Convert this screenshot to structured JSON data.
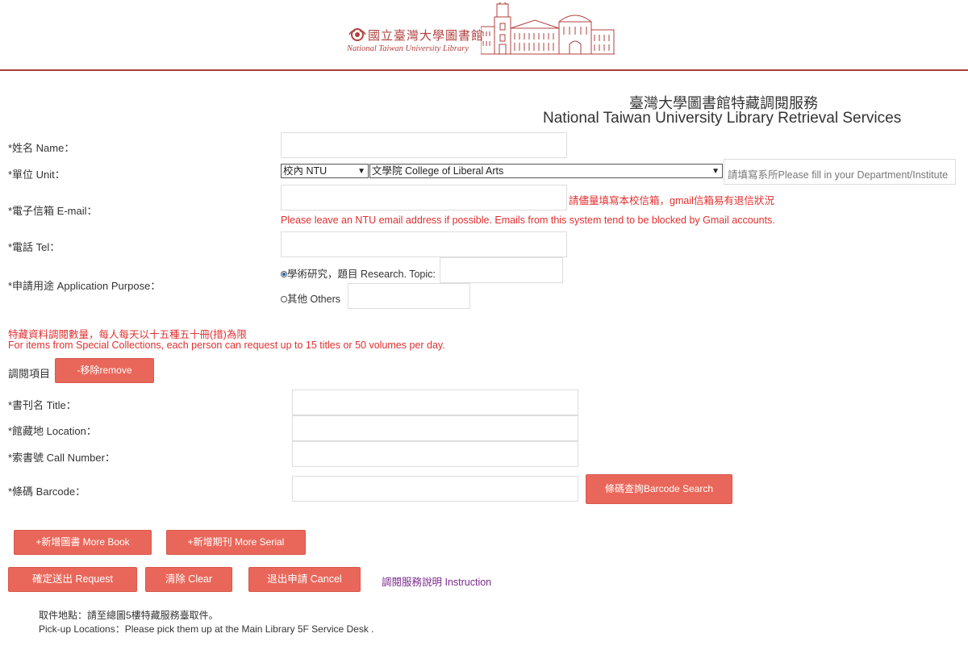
{
  "header": {
    "logo_cn": "國立臺灣大學圖書館",
    "logo_en": "National Taiwan University Library"
  },
  "page_title": {
    "cn": "臺灣大學圖書館特藏調閱服務",
    "en": "National Taiwan University Library Retrieval Services"
  },
  "form": {
    "name_label": "*姓名 Name：",
    "unit_label": "*單位 Unit：",
    "unit_select1": "校內 NTU",
    "unit_select2": "文學院 College of Liberal Arts",
    "dept_placeholder": "請填寫系所Please fill in your Department/Institute",
    "email_label": "*電子信箱 E-mail：",
    "email_note_cn": "請儘量填寫本校信箱，gmail信箱易有退信狀況",
    "email_note_en": "Please leave an NTU email address if possible. Emails from this system tend to be blocked by Gmail accounts.",
    "tel_label": "*電話 Tel：",
    "purpose_label": "*申請用途 Application Purpose：",
    "purpose_research": "學術研究，題目 Research. Topic:",
    "purpose_others": "其他 Others",
    "limit_cn": "特藏資料調閱數量，每人每天以十五種五十冊(措)為限",
    "limit_en": "For items from Special Collections, each person can request up to 15 titles or 50 volumes per day.",
    "items_label": "調閱項目",
    "remove_button": "-移除remove",
    "title_label": "*書刊名 Title：",
    "location_label": "*館藏地 Location：",
    "callno_label": "*索書號 Call Number：",
    "barcode_label": "*條碼 Barcode：",
    "barcode_search_button": "條碼查詢Barcode Search"
  },
  "actions": {
    "more_book": "+新增圖書 More Book",
    "more_serial": "+新增期刊 More Serial",
    "request": "確定送出 Request",
    "clear": "清除 Clear",
    "cancel": "退出申請 Cancel",
    "instruction": "調閱服務說明 Instruction"
  },
  "pickup": {
    "cn": "取件地點：請至總圖5樓特藏服務臺取件。",
    "en": "Pick-up Locations：Please pick them up at the Main Library 5F Service Desk ."
  },
  "colors": {
    "brand": "#b2403f",
    "button": "#e9675a",
    "warning": "#e03030",
    "link": "#7a2a8a"
  }
}
